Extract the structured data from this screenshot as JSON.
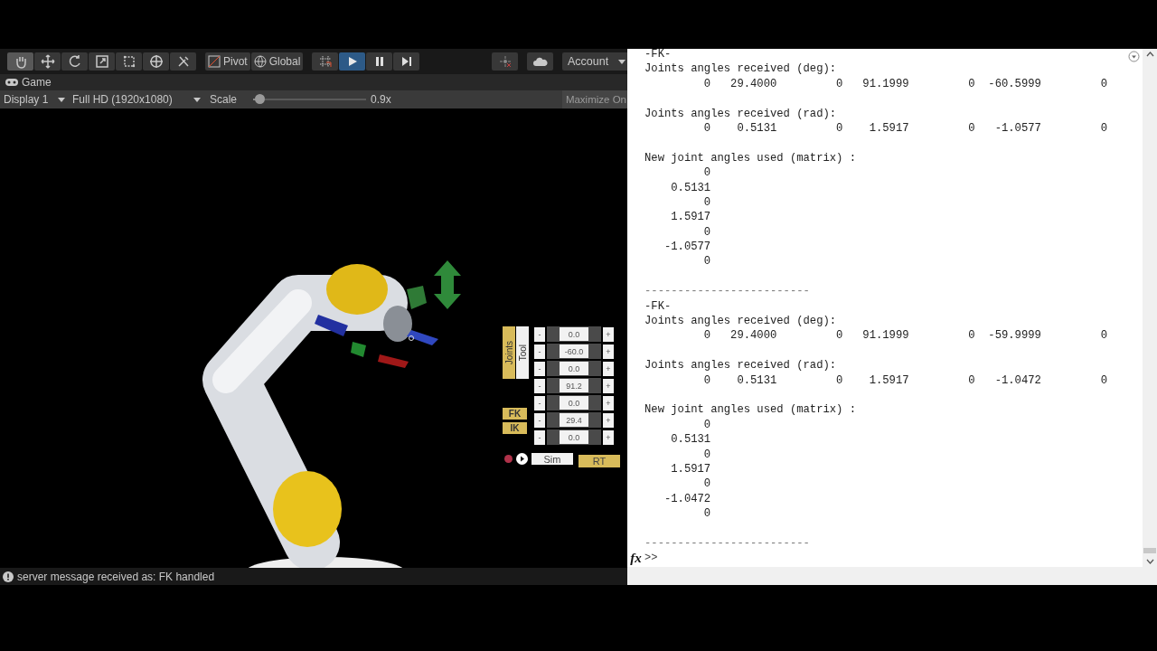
{
  "unity": {
    "toolbar": {
      "tools": [
        {
          "selected": true
        },
        {
          "selected": false
        },
        {
          "selected": false
        },
        {
          "selected": false
        },
        {
          "selected": false
        },
        {
          "selected": false
        },
        {
          "selected": false
        }
      ],
      "pivot": "Pivot",
      "global": "Global",
      "playback": [
        {
          "selected": true
        },
        {
          "selected": false
        },
        {
          "selected": false
        }
      ],
      "account": "Account"
    },
    "game_tab": {
      "label": "Game"
    },
    "game_toolbar": {
      "display": "Display 1",
      "resolution": "Full HD (1920x1080)",
      "scale_label": "Scale",
      "scale": {
        "level": 0.03
      },
      "scale_reading": "0.9x",
      "maximize": "Maximize On"
    },
    "robot_panel": {
      "modes": [
        {
          "label": "Joints",
          "selected": true
        },
        {
          "label": "Tool",
          "selected": false
        }
      ],
      "solvers": [
        {
          "label": "FK"
        },
        {
          "label": "IK"
        }
      ],
      "joints": [
        {
          "decrement": "-",
          "value": "0.0",
          "increment": "+"
        },
        {
          "decrement": "-",
          "value": "-60.0",
          "increment": "+"
        },
        {
          "decrement": "-",
          "value": "0.0",
          "increment": "+"
        },
        {
          "decrement": "-",
          "value": "91.2",
          "increment": "+"
        },
        {
          "decrement": "-",
          "value": "0.0",
          "increment": "+"
        },
        {
          "decrement": "-",
          "value": "29.4",
          "increment": "+"
        },
        {
          "decrement": "-",
          "value": "0.0",
          "increment": "+"
        }
      ],
      "targets": [
        {
          "label": "Sim",
          "selected": false
        },
        {
          "label": "RT",
          "selected": true
        }
      ]
    },
    "status_bar": {
      "message": "server message received as: FK handled"
    }
  },
  "command_window": {
    "lines": [
      {
        "kind": "text",
        "text": "-FK-"
      },
      {
        "kind": "text",
        "text": "Joints angles received (deg):"
      },
      {
        "kind": "text",
        "text": "         0   29.4000         0   91.1999         0  -60.5999         0"
      },
      {
        "kind": "blank"
      },
      {
        "kind": "text",
        "text": "Joints angles received (rad):"
      },
      {
        "kind": "text",
        "text": "         0    0.5131         0    1.5917         0   -1.0577         0"
      },
      {
        "kind": "blank"
      },
      {
        "kind": "text",
        "text": "New joint angles used (matrix) :"
      },
      {
        "kind": "text",
        "text": "         0"
      },
      {
        "kind": "text",
        "text": "    0.5131"
      },
      {
        "kind": "text",
        "text": "         0"
      },
      {
        "kind": "text",
        "text": "    1.5917"
      },
      {
        "kind": "text",
        "text": "         0"
      },
      {
        "kind": "text",
        "text": "   -1.0577"
      },
      {
        "kind": "text",
        "text": "         0"
      },
      {
        "kind": "blank"
      },
      {
        "kind": "separator",
        "text": "-------------------------"
      },
      {
        "kind": "text",
        "text": "-FK-"
      },
      {
        "kind": "text",
        "text": "Joints angles received (deg):"
      },
      {
        "kind": "text",
        "text": "         0   29.4000         0   91.1999         0  -59.9999         0"
      },
      {
        "kind": "blank"
      },
      {
        "kind": "text",
        "text": "Joints angles received (rad):"
      },
      {
        "kind": "text",
        "text": "         0    0.5131         0    1.5917         0   -1.0472         0"
      },
      {
        "kind": "blank"
      },
      {
        "kind": "text",
        "text": "New joint angles used (matrix) :"
      },
      {
        "kind": "text",
        "text": "         0"
      },
      {
        "kind": "text",
        "text": "    0.5131"
      },
      {
        "kind": "text",
        "text": "         0"
      },
      {
        "kind": "text",
        "text": "    1.5917"
      },
      {
        "kind": "text",
        "text": "         0"
      },
      {
        "kind": "text",
        "text": "   -1.0472"
      },
      {
        "kind": "text",
        "text": "         0"
      },
      {
        "kind": "blank"
      },
      {
        "kind": "separator",
        "text": "-------------------------"
      }
    ],
    "prompt_icon": "fx",
    "prompt": ">>"
  }
}
